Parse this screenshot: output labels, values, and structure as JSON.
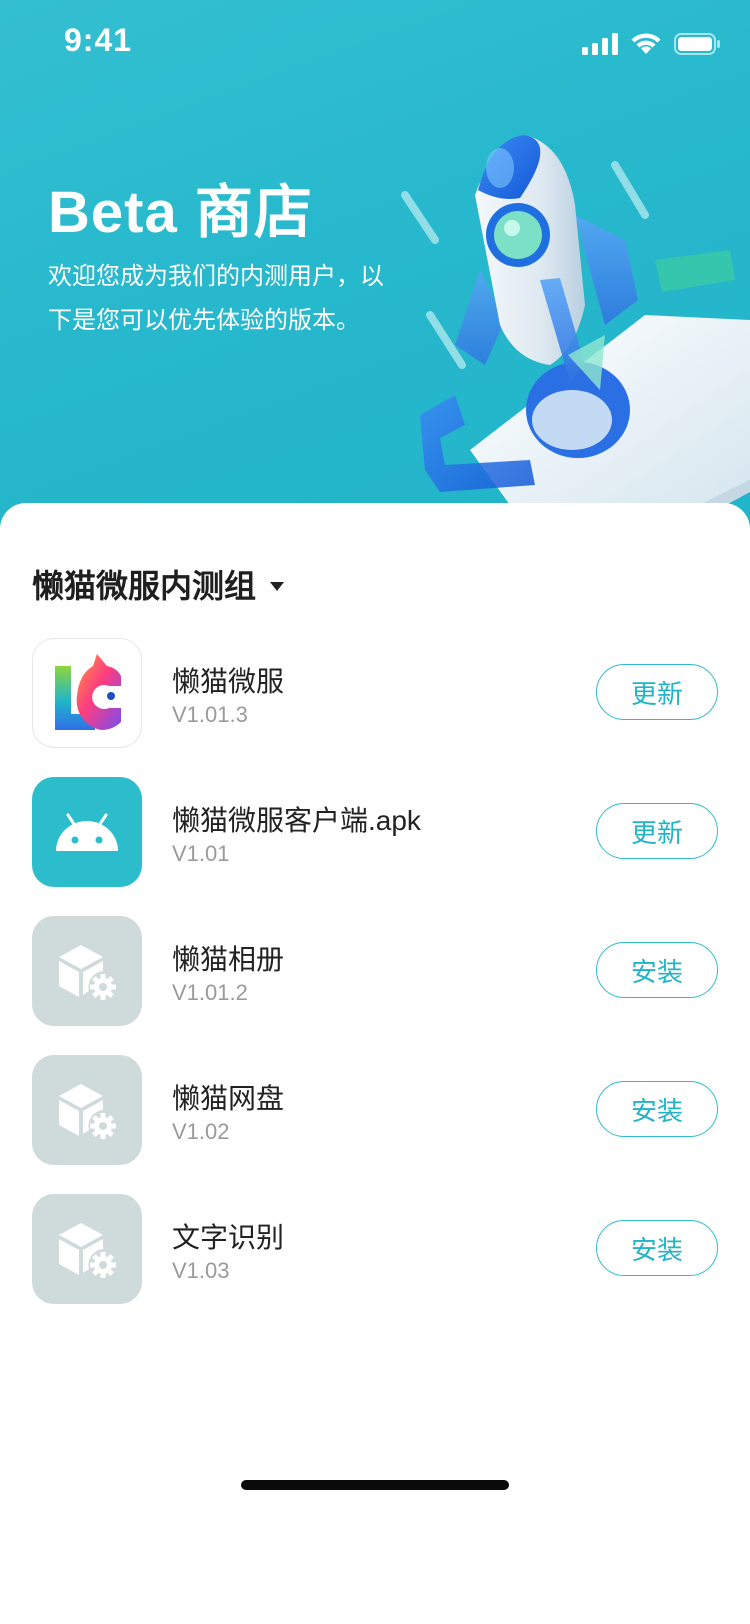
{
  "status_bar": {
    "time": "9:41"
  },
  "hero": {
    "title": "Beta 商店",
    "description_line1": "欢迎您成为我们的内测用户，以",
    "description_line2": "下是您可以优先体验的版本。"
  },
  "group": {
    "title": "懒猫微服内测组"
  },
  "apps": [
    {
      "name": "懒猫微服",
      "version": "V1.01.3",
      "action": "更新",
      "icon": "lc-logo-icon"
    },
    {
      "name": "懒猫微服客户端.apk",
      "version": "V1.01",
      "action": "更新",
      "icon": "android-icon"
    },
    {
      "name": "懒猫相册",
      "version": "V1.01.2",
      "action": "安装",
      "icon": "package-gear-icon"
    },
    {
      "name": "懒猫网盘",
      "version": "V1.02",
      "action": "安装",
      "icon": "package-gear-icon"
    },
    {
      "name": "文字识别",
      "version": "V1.03",
      "action": "安装",
      "icon": "package-gear-icon"
    }
  ],
  "colors": {
    "accent": "#2fbccd",
    "hero_bg": "#27b8cd",
    "generic_icon_bg": "#cfdadb"
  }
}
